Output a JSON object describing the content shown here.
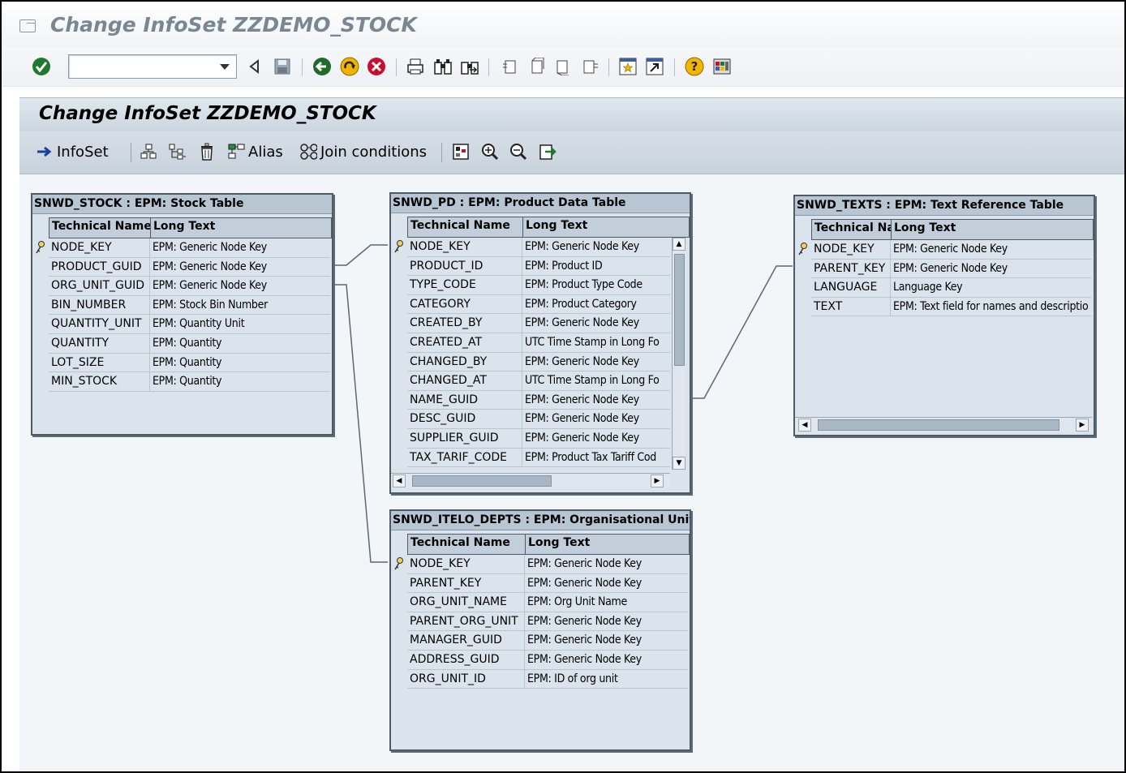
{
  "window": {
    "title": "Change InfoSet ZZDEMO_STOCK"
  },
  "system_toolbar": {
    "command_field": {
      "value": "",
      "placeholder": ""
    },
    "icons": [
      "enter-icon",
      "back-triangle-icon",
      "save-icon",
      "back-icon",
      "exit-icon",
      "cancel-icon",
      "print-icon",
      "find-icon",
      "find-next-icon",
      "first-page-icon",
      "previous-page-icon",
      "next-page-icon",
      "last-page-icon",
      "create-session-icon",
      "create-shortcut-icon",
      "help-icon",
      "customize-layout-icon"
    ]
  },
  "app": {
    "title": "Change InfoSet ZZDEMO_STOCK",
    "toolbar": {
      "infoset_label": "InfoSet",
      "alias_label": "Alias",
      "join_conditions_label": "Join conditions"
    }
  },
  "tables": {
    "stock": {
      "title": "SNWD_STOCK : EPM: Stock Table",
      "col_tech": "Technical Name",
      "col_long": "Long Text",
      "rows": [
        {
          "tech": "NODE_KEY",
          "long": "EPM: Generic Node Key",
          "key": true
        },
        {
          "tech": "PRODUCT_GUID",
          "long": "EPM: Generic Node Key",
          "key": false
        },
        {
          "tech": "ORG_UNIT_GUID",
          "long": "EPM: Generic Node Key",
          "key": false
        },
        {
          "tech": "BIN_NUMBER",
          "long": "EPM: Stock Bin Number",
          "key": false
        },
        {
          "tech": "QUANTITY_UNIT",
          "long": "EPM: Quantity Unit",
          "key": false
        },
        {
          "tech": "QUANTITY",
          "long": "EPM: Quantity",
          "key": false
        },
        {
          "tech": "LOT_SIZE",
          "long": "EPM: Quantity",
          "key": false
        },
        {
          "tech": "MIN_STOCK",
          "long": "EPM: Quantity",
          "key": false
        }
      ]
    },
    "pd": {
      "title": "SNWD_PD : EPM: Product Data Table",
      "col_tech": "Technical Name",
      "col_long": "Long Text",
      "rows": [
        {
          "tech": "NODE_KEY",
          "long": "EPM: Generic Node Key",
          "key": true
        },
        {
          "tech": "PRODUCT_ID",
          "long": "EPM: Product ID",
          "key": false
        },
        {
          "tech": "TYPE_CODE",
          "long": "EPM: Product Type Code",
          "key": false
        },
        {
          "tech": "CATEGORY",
          "long": "EPM: Product Category",
          "key": false
        },
        {
          "tech": "CREATED_BY",
          "long": "EPM: Generic Node Key",
          "key": false
        },
        {
          "tech": "CREATED_AT",
          "long": "UTC Time Stamp in Long Fo",
          "key": false
        },
        {
          "tech": "CHANGED_BY",
          "long": "EPM: Generic Node Key",
          "key": false
        },
        {
          "tech": "CHANGED_AT",
          "long": "UTC Time Stamp in Long Fo",
          "key": false
        },
        {
          "tech": "NAME_GUID",
          "long": "EPM: Generic Node Key",
          "key": false
        },
        {
          "tech": "DESC_GUID",
          "long": "EPM: Generic Node Key",
          "key": false
        },
        {
          "tech": "SUPPLIER_GUID",
          "long": "EPM: Generic Node Key",
          "key": false
        },
        {
          "tech": "TAX_TARIF_CODE",
          "long": "EPM: Product Tax Tariff Cod",
          "key": false
        }
      ]
    },
    "texts": {
      "title": "SNWD_TEXTS : EPM: Text Reference Table",
      "col_tech": "Technical Na",
      "col_long": "Long Text",
      "rows": [
        {
          "tech": "NODE_KEY",
          "long": "EPM: Generic Node Key",
          "key": true
        },
        {
          "tech": "PARENT_KEY",
          "long": "EPM: Generic Node Key",
          "key": false
        },
        {
          "tech": "LANGUAGE",
          "long": "Language Key",
          "key": false
        },
        {
          "tech": "TEXT",
          "long": "EPM: Text field for names and descriptio",
          "key": false
        }
      ]
    },
    "depts": {
      "title": "SNWD_ITELO_DEPTS : EPM: Organisational Unit T",
      "col_tech": "Technical Name",
      "col_long": "Long Text",
      "rows": [
        {
          "tech": "NODE_KEY",
          "long": "EPM: Generic Node Key",
          "key": true
        },
        {
          "tech": "PARENT_KEY",
          "long": "EPM: Generic Node Key",
          "key": false
        },
        {
          "tech": "ORG_UNIT_NAME",
          "long": "EPM: Org Unit Name",
          "key": false
        },
        {
          "tech": "PARENT_ORG_UNIT",
          "long": "EPM: Generic Node Key",
          "key": false
        },
        {
          "tech": "MANAGER_GUID",
          "long": "EPM: Generic Node Key",
          "key": false
        },
        {
          "tech": "ADDRESS_GUID",
          "long": "EPM: Generic Node Key",
          "key": false
        },
        {
          "tech": "ORG_UNIT_ID",
          "long": "EPM: ID of org unit",
          "key": false
        }
      ]
    }
  },
  "colors": {
    "app_bg": "#eef2f6",
    "table_bg": "#dbe4ec",
    "header_bg": "#b8c6d4",
    "border": "#4e5a66"
  }
}
